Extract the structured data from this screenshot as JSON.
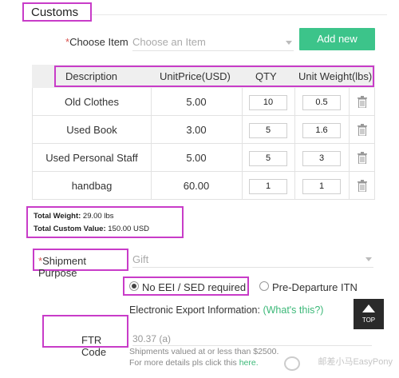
{
  "section": {
    "title": "Customs"
  },
  "choose_item": {
    "required_mark": "*",
    "label": "Choose Item",
    "placeholder": "Choose an Item",
    "add_button": "Add new"
  },
  "table": {
    "headers": [
      "Description",
      "UnitPrice(USD)",
      "QTY",
      "Unit Weight(lbs)"
    ],
    "rows": [
      {
        "description": "Old Clothes",
        "unit_price": "5.00",
        "qty": "10",
        "unit_weight": "0.5"
      },
      {
        "description": "Used Book",
        "unit_price": "3.00",
        "qty": "5",
        "unit_weight": "1.6"
      },
      {
        "description": "Used Personal Staff",
        "unit_price": "5.00",
        "qty": "5",
        "unit_weight": "3"
      },
      {
        "description": "handbag",
        "unit_price": "60.00",
        "qty": "1",
        "unit_weight": "1"
      }
    ]
  },
  "totals": {
    "weight_label": "Total Weight:",
    "weight_value": "29.00 lbs",
    "value_label": "Total Custom Value:",
    "value_value": "150.00 USD"
  },
  "shipment_purpose": {
    "required_mark": "*",
    "label": "Shipment Purpose",
    "value": "Gift"
  },
  "export_options": {
    "option1": "No EEI / SED required",
    "option2": "Pre-Departure ITN",
    "selected": "No EEI / SED required"
  },
  "eei": {
    "text": "Electronic Export Information:",
    "link": "(What's this?)"
  },
  "ftr": {
    "label": "FTR Code",
    "value": "30.37 (a)",
    "note_line1": "Shipments valued at or less than $2500.",
    "note_line2_prefix": "For more details pls click this ",
    "note_line2_link": "here."
  },
  "top_button": {
    "label": "TOP"
  },
  "watermark": {
    "text": "邮差小马EasyPony"
  },
  "colors": {
    "accent_green": "#3cc48a",
    "highlight": "#c83cc8",
    "required_red": "#d9534f"
  }
}
